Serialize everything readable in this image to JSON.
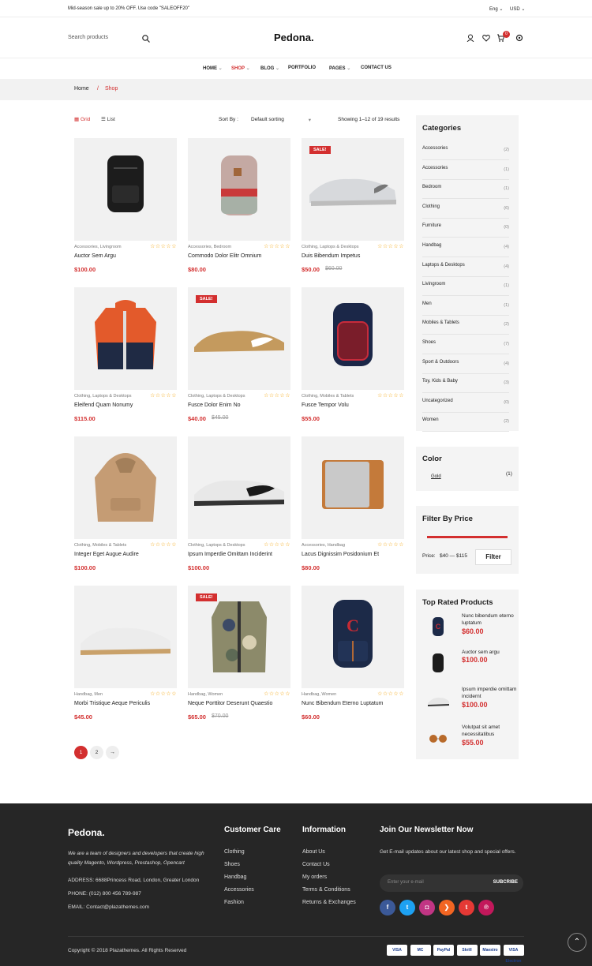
{
  "topbar": {
    "promo": "Mid-season sale up to 20% OFF. Use code \"SALEOFF20\"",
    "lang": "Eng",
    "currency": "USD"
  },
  "header": {
    "search_placeholder": "Search products",
    "logo": "Pedona.",
    "cart_count": "0"
  },
  "nav": [
    {
      "label": "HOME"
    },
    {
      "label": "SHOP"
    },
    {
      "label": "BLOG"
    },
    {
      "label": "PORTFOLIO"
    },
    {
      "label": "PAGES"
    },
    {
      "label": "CONTACT US"
    }
  ],
  "breadcrumb": {
    "home": "Home",
    "sep": "/",
    "current": "Shop"
  },
  "toolbar": {
    "grid": "Grid",
    "list": "List",
    "sort_label": "Sort By :",
    "sort_value": "Default sorting",
    "results": "Showing 1–12 of 19 results"
  },
  "products": [
    {
      "cats": "Accessories, Livingroom",
      "title": "Auctor Sem Argu",
      "price": "$100.00",
      "old": "",
      "sale": "",
      "img": "backpack-black"
    },
    {
      "cats": "Accessories, Bedroom",
      "title": "Commodo Dolor Elitr Omnium",
      "price": "$80.00",
      "old": "",
      "sale": "",
      "img": "backpack-pink"
    },
    {
      "cats": "Clothing, Laptops & Desktops",
      "title": "Duis Bibendum Impetus",
      "price": "$50.00",
      "old": "$60.00",
      "sale": "SALE!",
      "img": "shoe-grey"
    },
    {
      "cats": "Clothing, Laptops & Desktops",
      "title": "Eleifend Quam Nonumy",
      "price": "$115.00",
      "old": "",
      "sale": "",
      "img": "jacket"
    },
    {
      "cats": "Clothing, Laptops & Desktops",
      "title": "Fusce Dolor Enim No",
      "price": "$40.00",
      "old": "$45.00",
      "sale": "SALE!",
      "img": "shoe-tan"
    },
    {
      "cats": "Clothing, Mobiles & Tablets",
      "title": "Fusce Tempor Volu",
      "price": "$55.00",
      "old": "",
      "sale": "",
      "img": "backpack-navy"
    },
    {
      "cats": "Clothing, Mobiles & Tablets",
      "title": "Integer Eget Augue Audire",
      "price": "$100.00",
      "old": "",
      "sale": "",
      "img": "hoodie"
    },
    {
      "cats": "Clothing, Laptops & Desktops",
      "title": "Ipsum Imperdie Omittam Inciderint",
      "price": "$100.00",
      "old": "",
      "sale": "",
      "img": "shoe-white"
    },
    {
      "cats": "Accessories, Handbag",
      "title": "Lacus Dignissim Posidonium Et",
      "price": "$80.00",
      "old": "",
      "sale": "",
      "img": "wallet"
    },
    {
      "cats": "Handbag, Men",
      "title": "Morbi Tristique Aeque Periculis",
      "price": "$45.00",
      "old": "",
      "sale": "",
      "img": "shoe-white2"
    },
    {
      "cats": "Handbag, Women",
      "title": "Neque Porttitor Deserunt Quaestio",
      "price": "$65.00",
      "old": "$70.00",
      "sale": "SALE!",
      "img": "vest"
    },
    {
      "cats": "Handbag, Women",
      "title": "Nunc Bibendum Eterno Luptatum",
      "price": "$60.00",
      "old": "",
      "sale": "",
      "img": "backpack-c"
    }
  ],
  "pagination": [
    "1",
    "2",
    "→"
  ],
  "categories": {
    "title": "Categories",
    "items": [
      {
        "name": "Accessories",
        "count": "(2)"
      },
      {
        "name": "Accessories",
        "count": "(1)"
      },
      {
        "name": "Bedroom",
        "count": "(1)"
      },
      {
        "name": "Clothing",
        "count": "(6)"
      },
      {
        "name": "Furniture",
        "count": "(0)"
      },
      {
        "name": "Handbag",
        "count": "(4)"
      },
      {
        "name": "Laptops & Desktops",
        "count": "(4)"
      },
      {
        "name": "Livingroom",
        "count": "(1)"
      },
      {
        "name": "Men",
        "count": "(1)"
      },
      {
        "name": "Mobiles & Tablets",
        "count": "(2)"
      },
      {
        "name": "Shoes",
        "count": "(7)"
      },
      {
        "name": "Sport & Outdoors",
        "count": "(4)"
      },
      {
        "name": "Toy, Kids & Baby",
        "count": "(3)"
      },
      {
        "name": "Uncategorized",
        "count": "(0)"
      },
      {
        "name": "Women",
        "count": "(2)"
      }
    ]
  },
  "color": {
    "title": "Color",
    "item": "Gold",
    "count": "(1)"
  },
  "price_filter": {
    "title": "Filter By Price",
    "label": "Price:",
    "range": "$40 — $115",
    "button": "Filter"
  },
  "top_rated": {
    "title": "Top Rated Products",
    "items": [
      {
        "name": "Nunc bibendum eterno luptatum",
        "price": "$60.00"
      },
      {
        "name": "Auctor sem argu",
        "price": "$100.00"
      },
      {
        "name": "Ipsum imperdie omittam incidernt",
        "price": "$100.00"
      },
      {
        "name": "Volutpat sit amet necessitatibus",
        "price": "$55.00"
      }
    ]
  },
  "footer": {
    "logo": "Pedona.",
    "about": "We are a team of designers and developers that create high quality Magento, Wordpress, Prestashop, Opencart",
    "address": "ADDRESS: 6688Princess Road, London, Greater London",
    "phone": "PHONE: (012) 800 456 789-987",
    "email": "EMAIL: Contact@plazathemes.com",
    "care_title": "Customer Care",
    "care": [
      "Clothing",
      "Shoes",
      "Handbag",
      "Accessories",
      "Fashion"
    ],
    "info_title": "Information",
    "info": [
      "About Us",
      "Contact Us",
      "My orders",
      "Terms & Conditions",
      "Returns & Exchanges"
    ],
    "news_title": "Join Our Newsletter Now",
    "news_text": "Get E-mail updates about our latest shop and special offers.",
    "news_placeholder": "Enter your e-mail",
    "subscribe": "SUBCRIBE",
    "social": [
      {
        "icon": "f",
        "color": "#3b5998"
      },
      {
        "icon": "t",
        "color": "#1da1f2"
      },
      {
        "icon": "◘",
        "color": "#c13584"
      },
      {
        "icon": "❯",
        "color": "#f26522"
      },
      {
        "icon": "t",
        "color": "#e53935"
      },
      {
        "icon": "℗",
        "color": "#c2185b"
      }
    ],
    "copyright": "Copyright © 2018 Plazathemes. All Rights Reserved",
    "payments": [
      "VISA",
      "MC",
      "PayPal",
      "Skrill",
      "Maestro",
      "VISA Electron"
    ]
  },
  "colors": {
    "accent": "#d32f2f",
    "footer_bg": "#262626"
  }
}
